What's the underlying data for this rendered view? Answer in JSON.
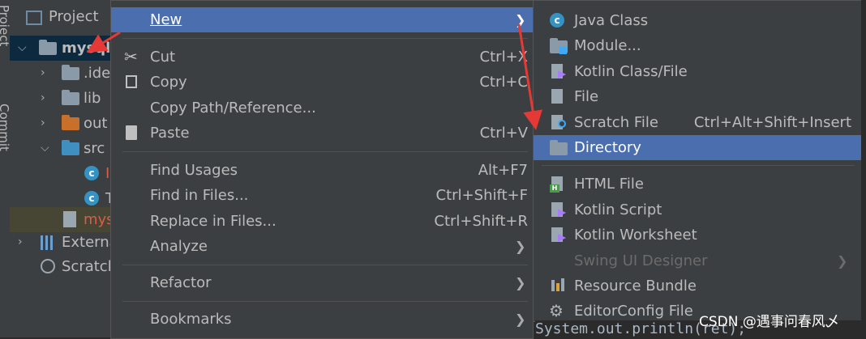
{
  "left_strip": {
    "project_label": "Project",
    "commit_label": "Commit"
  },
  "project_panel": {
    "header": "Project",
    "rows": [
      {
        "label": "mysql_",
        "kind": "module"
      },
      {
        "label": ".ide",
        "kind": "folder"
      },
      {
        "label": "lib",
        "kind": "folder"
      },
      {
        "label": "out",
        "kind": "folder-orange"
      },
      {
        "label": "src",
        "kind": "folder-blue"
      },
      {
        "label": "I",
        "kind": "class"
      },
      {
        "label": "T",
        "kind": "class"
      },
      {
        "label": "mys",
        "kind": "file"
      },
      {
        "label": "Externa",
        "kind": "libraries"
      },
      {
        "label": "Scratch",
        "kind": "scratch"
      }
    ]
  },
  "context_menu": {
    "new": {
      "label": "New",
      "mnemonic": "N"
    },
    "cut": {
      "label": "Cut",
      "shortcut": "Ctrl+X"
    },
    "copy": {
      "label": "Copy",
      "shortcut": "Ctrl+C"
    },
    "copy_path": {
      "label": "Copy Path/Reference..."
    },
    "paste": {
      "label": "Paste",
      "shortcut": "Ctrl+V"
    },
    "find_usages": {
      "label": "Find Usages",
      "shortcut": "Alt+F7"
    },
    "find_in_files": {
      "label": "Find in Files...",
      "shortcut": "Ctrl+Shift+F"
    },
    "replace_in_files": {
      "label": "Replace in Files...",
      "shortcut": "Ctrl+Shift+R"
    },
    "analyze": {
      "label": "Analyze"
    },
    "refactor": {
      "label": "Refactor"
    },
    "bookmarks": {
      "label": "Bookmarks"
    }
  },
  "new_submenu": {
    "java_class": "Java Class",
    "module": "Module...",
    "kotlin_class": "Kotlin Class/File",
    "file": "File",
    "scratch_file": {
      "label": "Scratch File",
      "shortcut": "Ctrl+Alt+Shift+Insert"
    },
    "directory": "Directory",
    "html_file": "HTML File",
    "kotlin_script": "Kotlin Script",
    "kotlin_worksheet": "Kotlin Worksheet",
    "swing_ui_designer": "Swing UI Designer",
    "resource_bundle": "Resource Bundle",
    "editorconfig_file": "EditorConfig File"
  },
  "code_peek": "System.out.println(ret);",
  "watermark": "CSDN @遇事问春风乄",
  "colors": {
    "accent": "#4b6eaf",
    "annotation_arrow": "#e53935",
    "menu_bg": "#3c3f41"
  }
}
